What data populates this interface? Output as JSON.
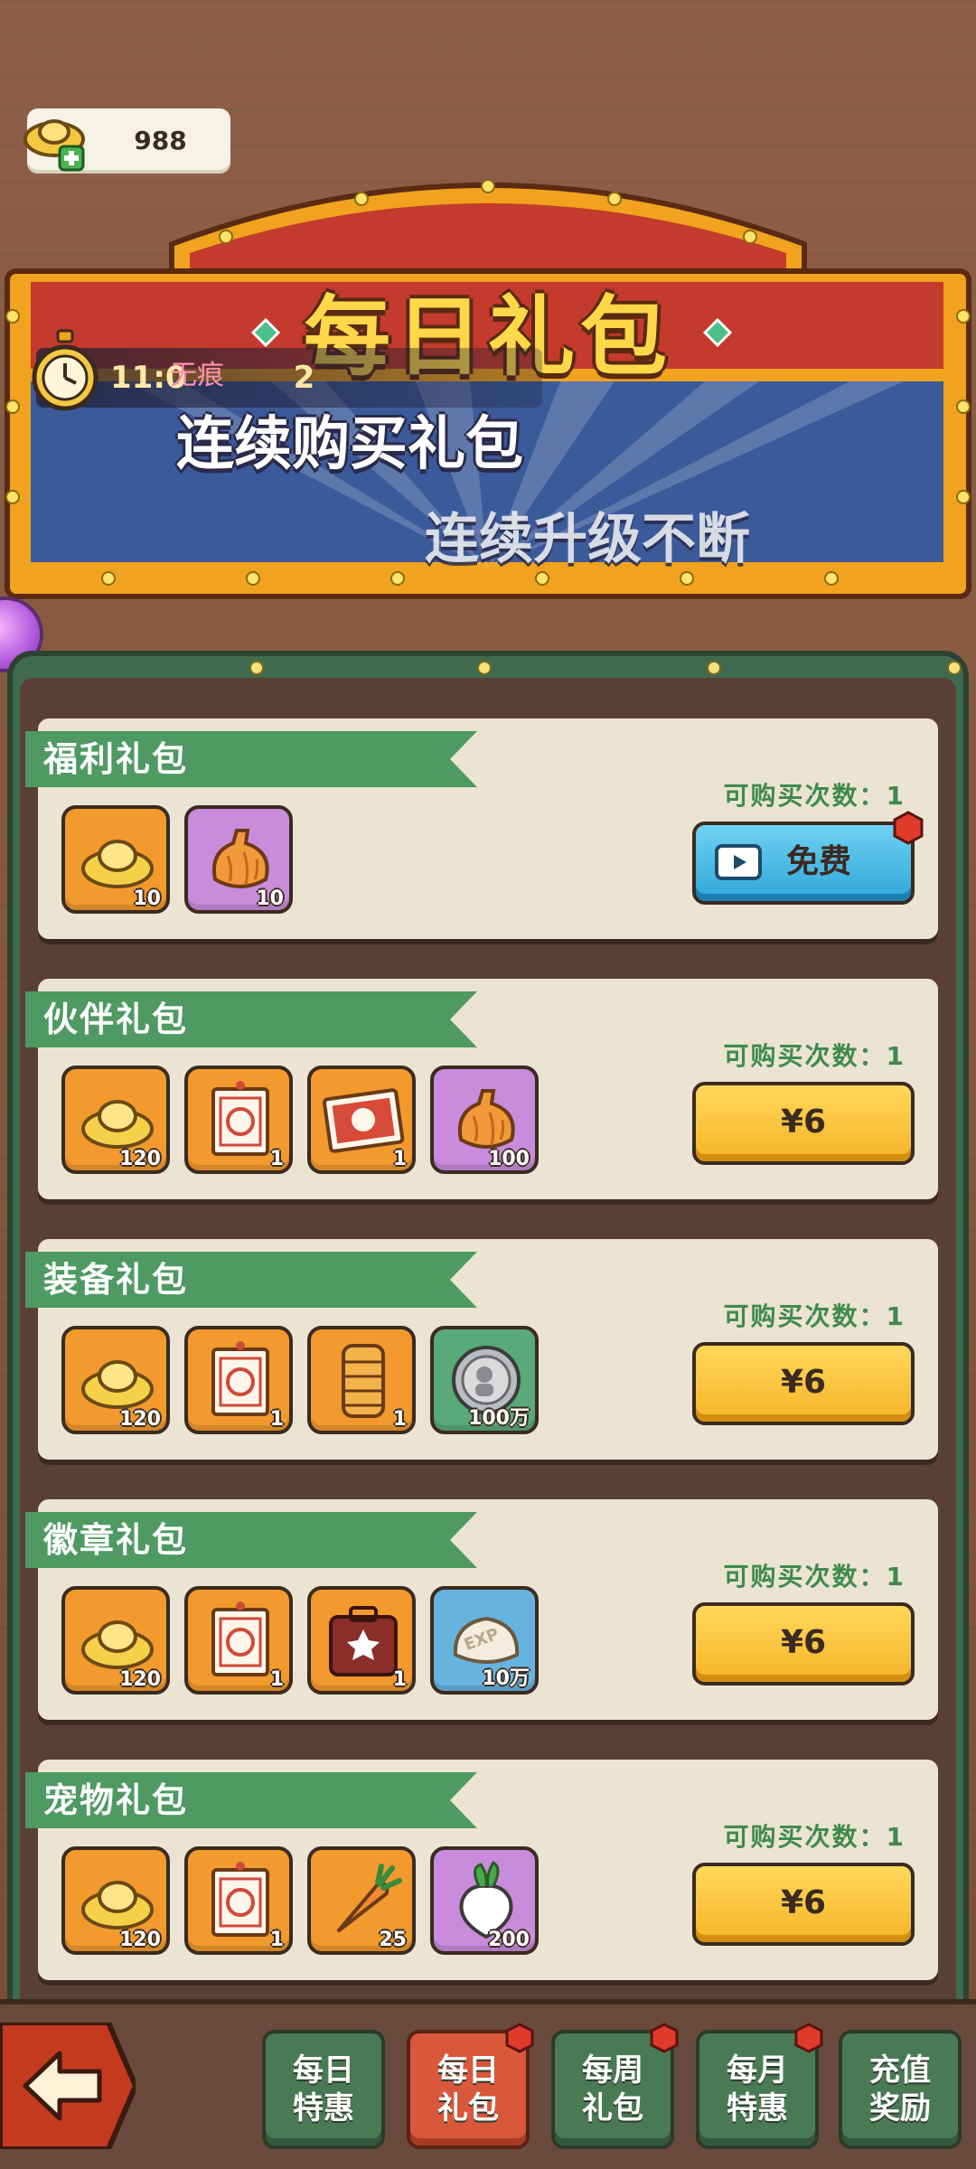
{
  "currency": {
    "amount": "988",
    "icon": "gold-ingot-plus-icon"
  },
  "banner": {
    "title": "每日礼包",
    "line1": "连续购买礼包",
    "line2": "连续升级不断",
    "timer": "11:0",
    "timer_tail": "2",
    "overlay_text": "无痕"
  },
  "packages": [
    {
      "title": "福利礼包",
      "limit": "可购买次数：1",
      "button": "免费",
      "button_type": "free",
      "items": [
        {
          "icon": "gold-ingot-icon",
          "qty": "10",
          "bg": "orange"
        },
        {
          "icon": "dumpling-bag-icon",
          "qty": "10",
          "bg": "purple"
        }
      ]
    },
    {
      "title": "伙伴礼包",
      "limit": "可购买次数：1",
      "button": "¥6",
      "button_type": "pay",
      "items": [
        {
          "icon": "gold-ingot-icon",
          "qty": "120",
          "bg": "orange"
        },
        {
          "icon": "good-ticket-icon",
          "qty": "1",
          "bg": "orange"
        },
        {
          "icon": "premium-ticket-icon",
          "qty": "1",
          "bg": "orange"
        },
        {
          "icon": "dumpling-bag-icon",
          "qty": "100",
          "bg": "purple"
        }
      ]
    },
    {
      "title": "装备礼包",
      "limit": "可购买次数：1",
      "button": "¥6",
      "button_type": "pay",
      "items": [
        {
          "icon": "gold-ingot-icon",
          "qty": "120",
          "bg": "orange"
        },
        {
          "icon": "good-ticket-icon",
          "qty": "1",
          "bg": "orange"
        },
        {
          "icon": "scroll-icon",
          "qty": "1",
          "bg": "orange"
        },
        {
          "icon": "silver-coin-icon",
          "qty": "100万",
          "bg": "green"
        }
      ]
    },
    {
      "title": "徽章礼包",
      "limit": "可购买次数：1",
      "button": "¥6",
      "button_type": "pay",
      "items": [
        {
          "icon": "gold-ingot-icon",
          "qty": "120",
          "bg": "orange"
        },
        {
          "icon": "good-ticket-icon",
          "qty": "1",
          "bg": "orange"
        },
        {
          "icon": "badge-case-icon",
          "qty": "1",
          "bg": "orange"
        },
        {
          "icon": "exp-bun-icon",
          "qty": "10万",
          "bg": "blue"
        }
      ]
    },
    {
      "title": "宠物礼包",
      "limit": "可购买次数：1",
      "button": "¥6",
      "button_type": "pay",
      "items": [
        {
          "icon": "gold-ingot-icon",
          "qty": "120",
          "bg": "orange"
        },
        {
          "icon": "good-ticket-icon",
          "qty": "1",
          "bg": "orange"
        },
        {
          "icon": "carrot-icon",
          "qty": "25",
          "bg": "orange"
        },
        {
          "icon": "radish-icon",
          "qty": "200",
          "bg": "purple"
        }
      ]
    }
  ],
  "nav": {
    "back_icon": "back-arrow-icon",
    "tabs": [
      {
        "line1": "每日",
        "line2": "特惠",
        "active": false,
        "badge": false
      },
      {
        "line1": "每日",
        "line2": "礼包",
        "active": true,
        "badge": true
      },
      {
        "line1": "每周",
        "line2": "礼包",
        "active": false,
        "badge": true
      },
      {
        "line1": "每月",
        "line2": "特惠",
        "active": false,
        "badge": true
      },
      {
        "line1": "充值",
        "line2": "奖励",
        "active": false,
        "badge": false
      }
    ]
  },
  "colors": {
    "wood": "#8a5a44",
    "board_green": "#3f6a4e",
    "ribbon_green": "#4e9a62",
    "card_bg": "#ece4d2",
    "price_button": "#f5b428",
    "free_button": "#2fa6da",
    "active_tab": "#d9573a",
    "inactive_tab": "#4a7a54",
    "title_yellow": "#ffd84a"
  }
}
